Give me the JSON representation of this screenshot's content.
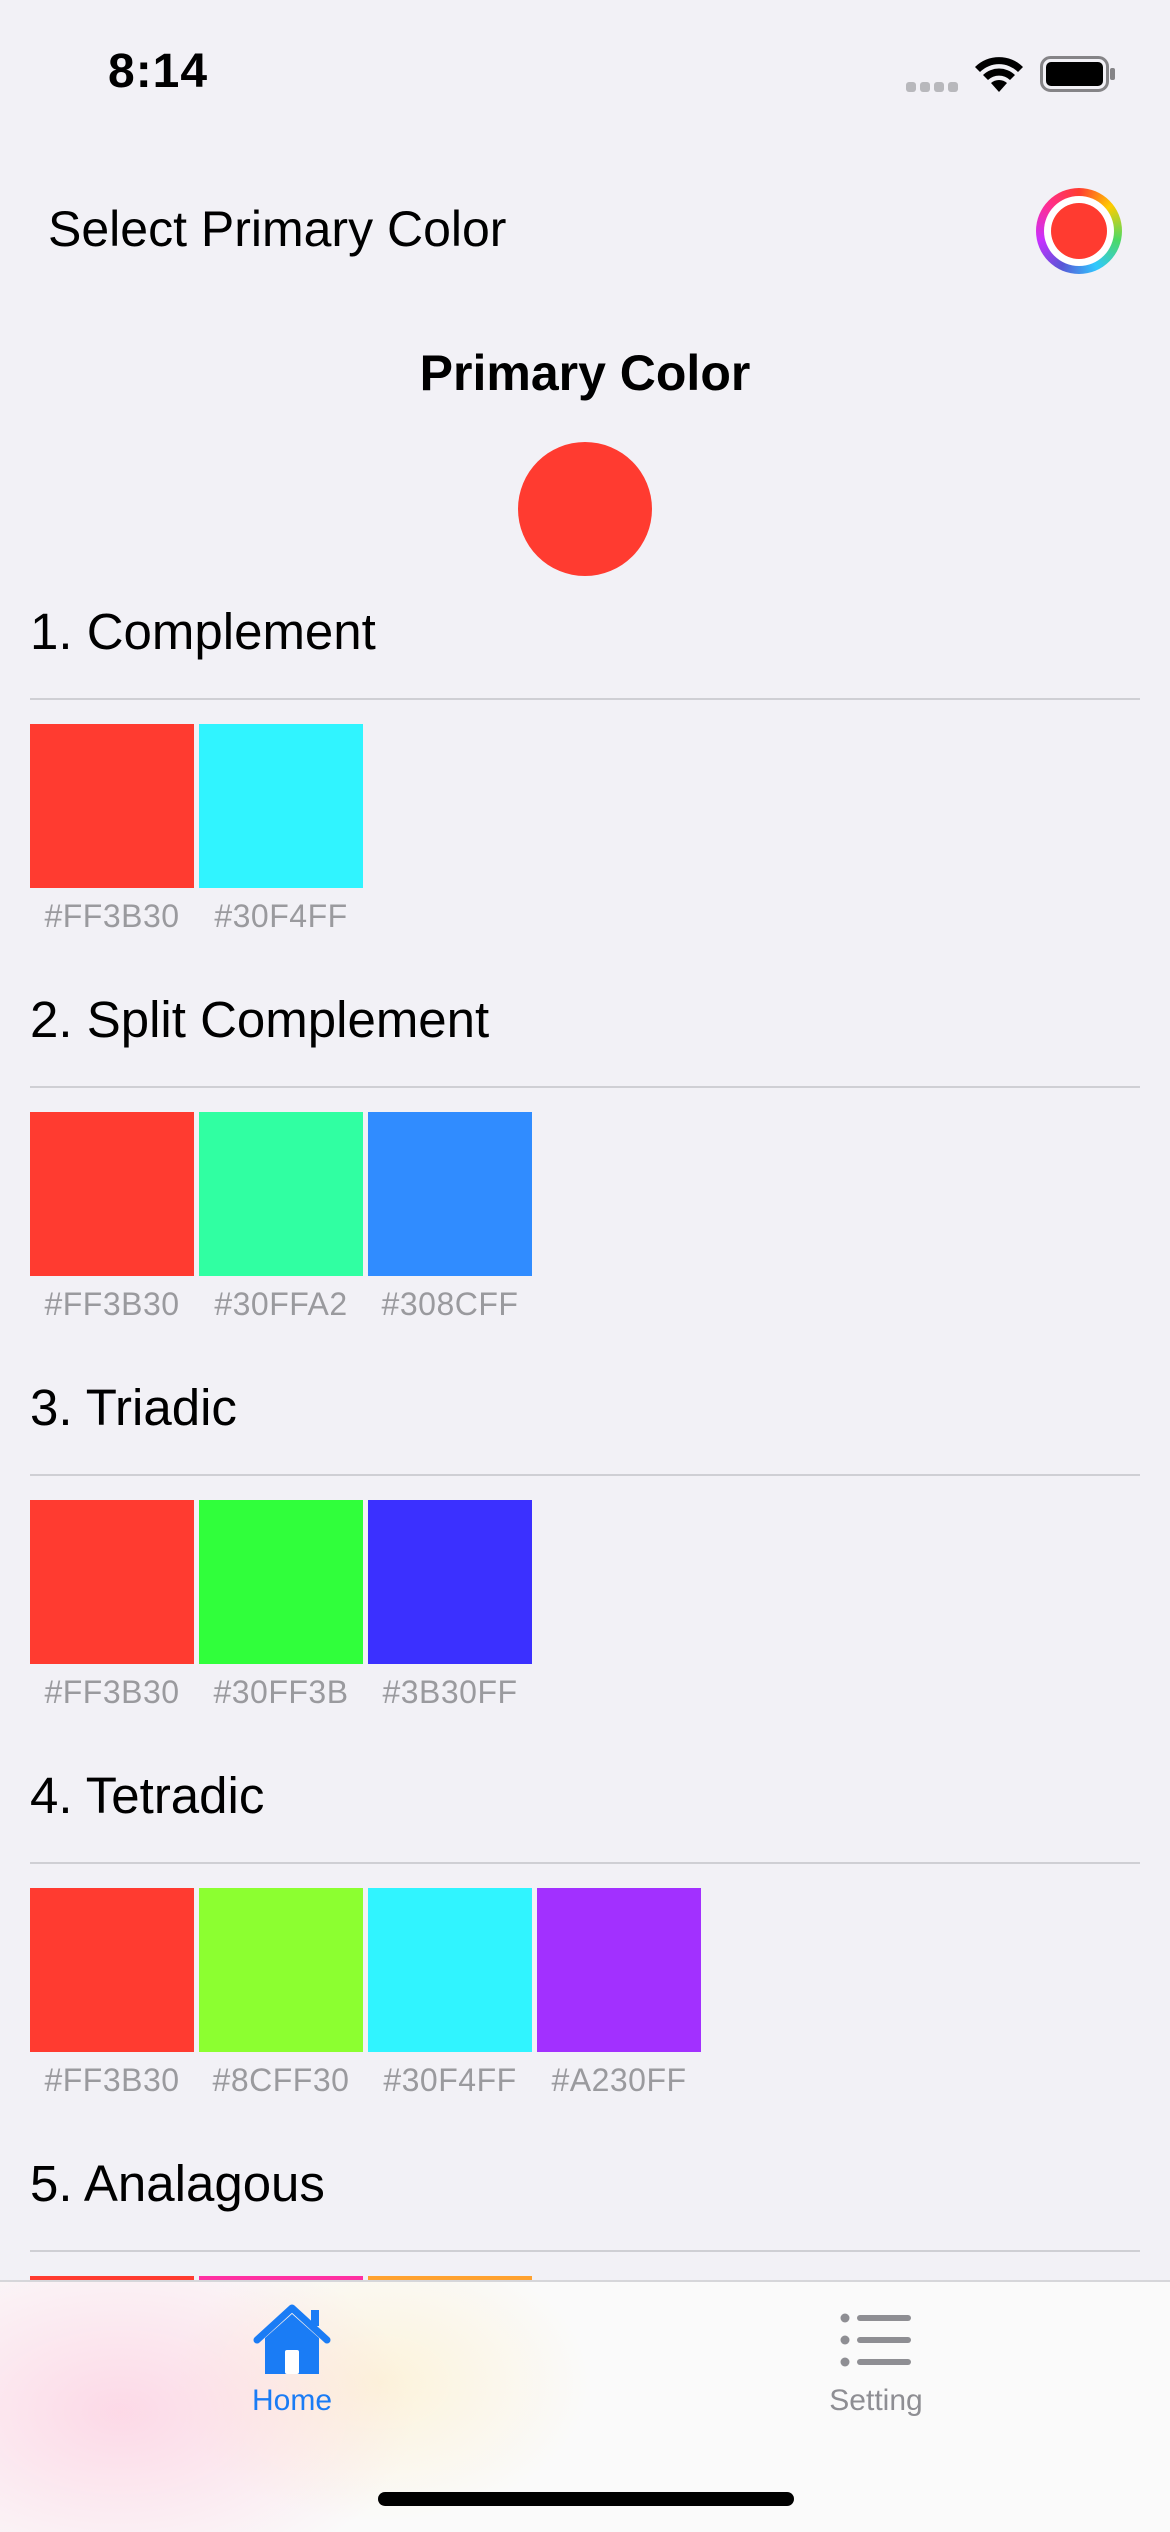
{
  "status_bar": {
    "time": "8:14"
  },
  "header": {
    "title": "Select Primary Color",
    "picker_icon": "color-wheel-icon"
  },
  "primary": {
    "heading": "Primary Color",
    "color": "#FF3B30"
  },
  "sections": [
    {
      "title": "1. Complement",
      "swatches": [
        {
          "hex": "#FF3B30"
        },
        {
          "hex": "#30F4FF"
        }
      ]
    },
    {
      "title": "2. Split Complement",
      "swatches": [
        {
          "hex": "#FF3B30"
        },
        {
          "hex": "#30FFA2"
        },
        {
          "hex": "#308CFF"
        }
      ]
    },
    {
      "title": "3. Triadic",
      "swatches": [
        {
          "hex": "#FF3B30"
        },
        {
          "hex": "#30FF3B"
        },
        {
          "hex": "#3B30FF"
        }
      ]
    },
    {
      "title": "4. Tetradic",
      "swatches": [
        {
          "hex": "#FF3B30"
        },
        {
          "hex": "#8CFF30"
        },
        {
          "hex": "#30F4FF"
        },
        {
          "hex": "#A230FF"
        }
      ]
    },
    {
      "title": "5. Analagous",
      "swatches": []
    }
  ],
  "tab_bar": {
    "tabs": [
      {
        "label": "Home",
        "icon": "house-icon",
        "active": true,
        "color": "#1a7cf5"
      },
      {
        "label": "Setting",
        "icon": "list-icon",
        "active": false,
        "color": "#8e8e93"
      }
    ]
  },
  "colors": {
    "background": "#F2F1F6",
    "accent": "#1A7CF5"
  }
}
